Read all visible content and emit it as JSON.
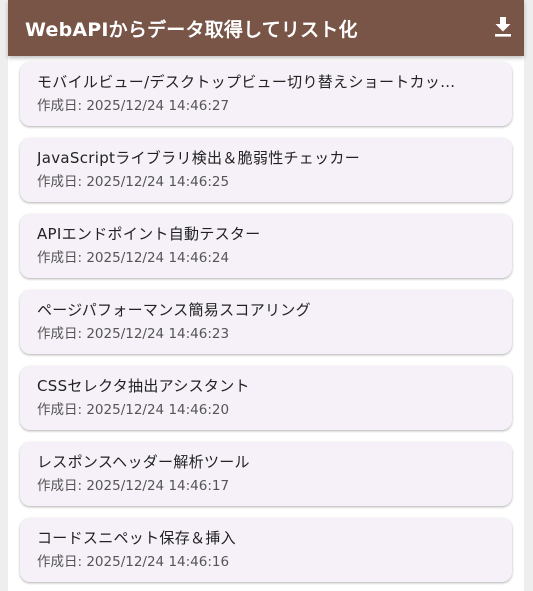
{
  "appbar": {
    "title": "WebAPIからデータ取得してリスト化",
    "download_icon": "download-icon",
    "background": "#795548"
  },
  "items": [
    {
      "title": "モバイルビュー/デスクトップビュー切り替えショートカッ…",
      "subtitle": "作成日: 2025/12/24 14:46:27"
    },
    {
      "title": "JavaScriptライブラリ検出＆脆弱性チェッカー",
      "subtitle": "作成日: 2025/12/24 14:46:25"
    },
    {
      "title": "APIエンドポイント自動テスター",
      "subtitle": "作成日: 2025/12/24 14:46:24"
    },
    {
      "title": "ページパフォーマンス簡易スコアリング",
      "subtitle": "作成日: 2025/12/24 14:46:23"
    },
    {
      "title": "CSSセレクタ抽出アシスタント",
      "subtitle": "作成日: 2025/12/24 14:46:20"
    },
    {
      "title": "レスポンスヘッダー解析ツール",
      "subtitle": "作成日: 2025/12/24 14:46:17"
    },
    {
      "title": "コードスニペット保存＆挿入",
      "subtitle": "作成日: 2025/12/24 14:46:16"
    }
  ]
}
